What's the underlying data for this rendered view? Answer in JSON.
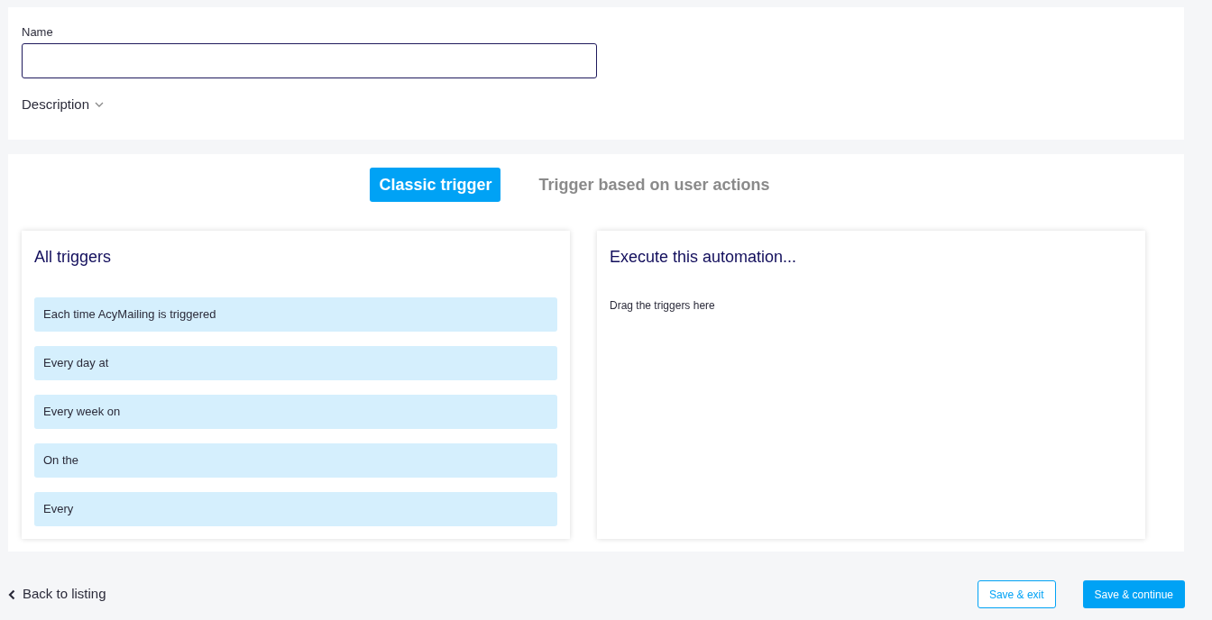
{
  "form": {
    "name_label": "Name",
    "description_label": "Description",
    "description_expanded": false
  },
  "tabs": [
    {
      "label": "Classic trigger",
      "selected": true
    },
    {
      "label": "Trigger based on user actions",
      "selected": false
    }
  ],
  "all_triggers": {
    "title": "All triggers",
    "items": [
      "Each time AcyMailing is triggered",
      "Every day at",
      "Every week on",
      "On the",
      "Every"
    ]
  },
  "execute": {
    "title": "Execute this automation...",
    "hint": "Drag the triggers here"
  },
  "footer": {
    "back": "Back to listing",
    "buttons": [
      {
        "label": "Save & exit",
        "kind": "outline"
      },
      {
        "label": "Save & continue",
        "kind": "primary"
      }
    ]
  }
}
